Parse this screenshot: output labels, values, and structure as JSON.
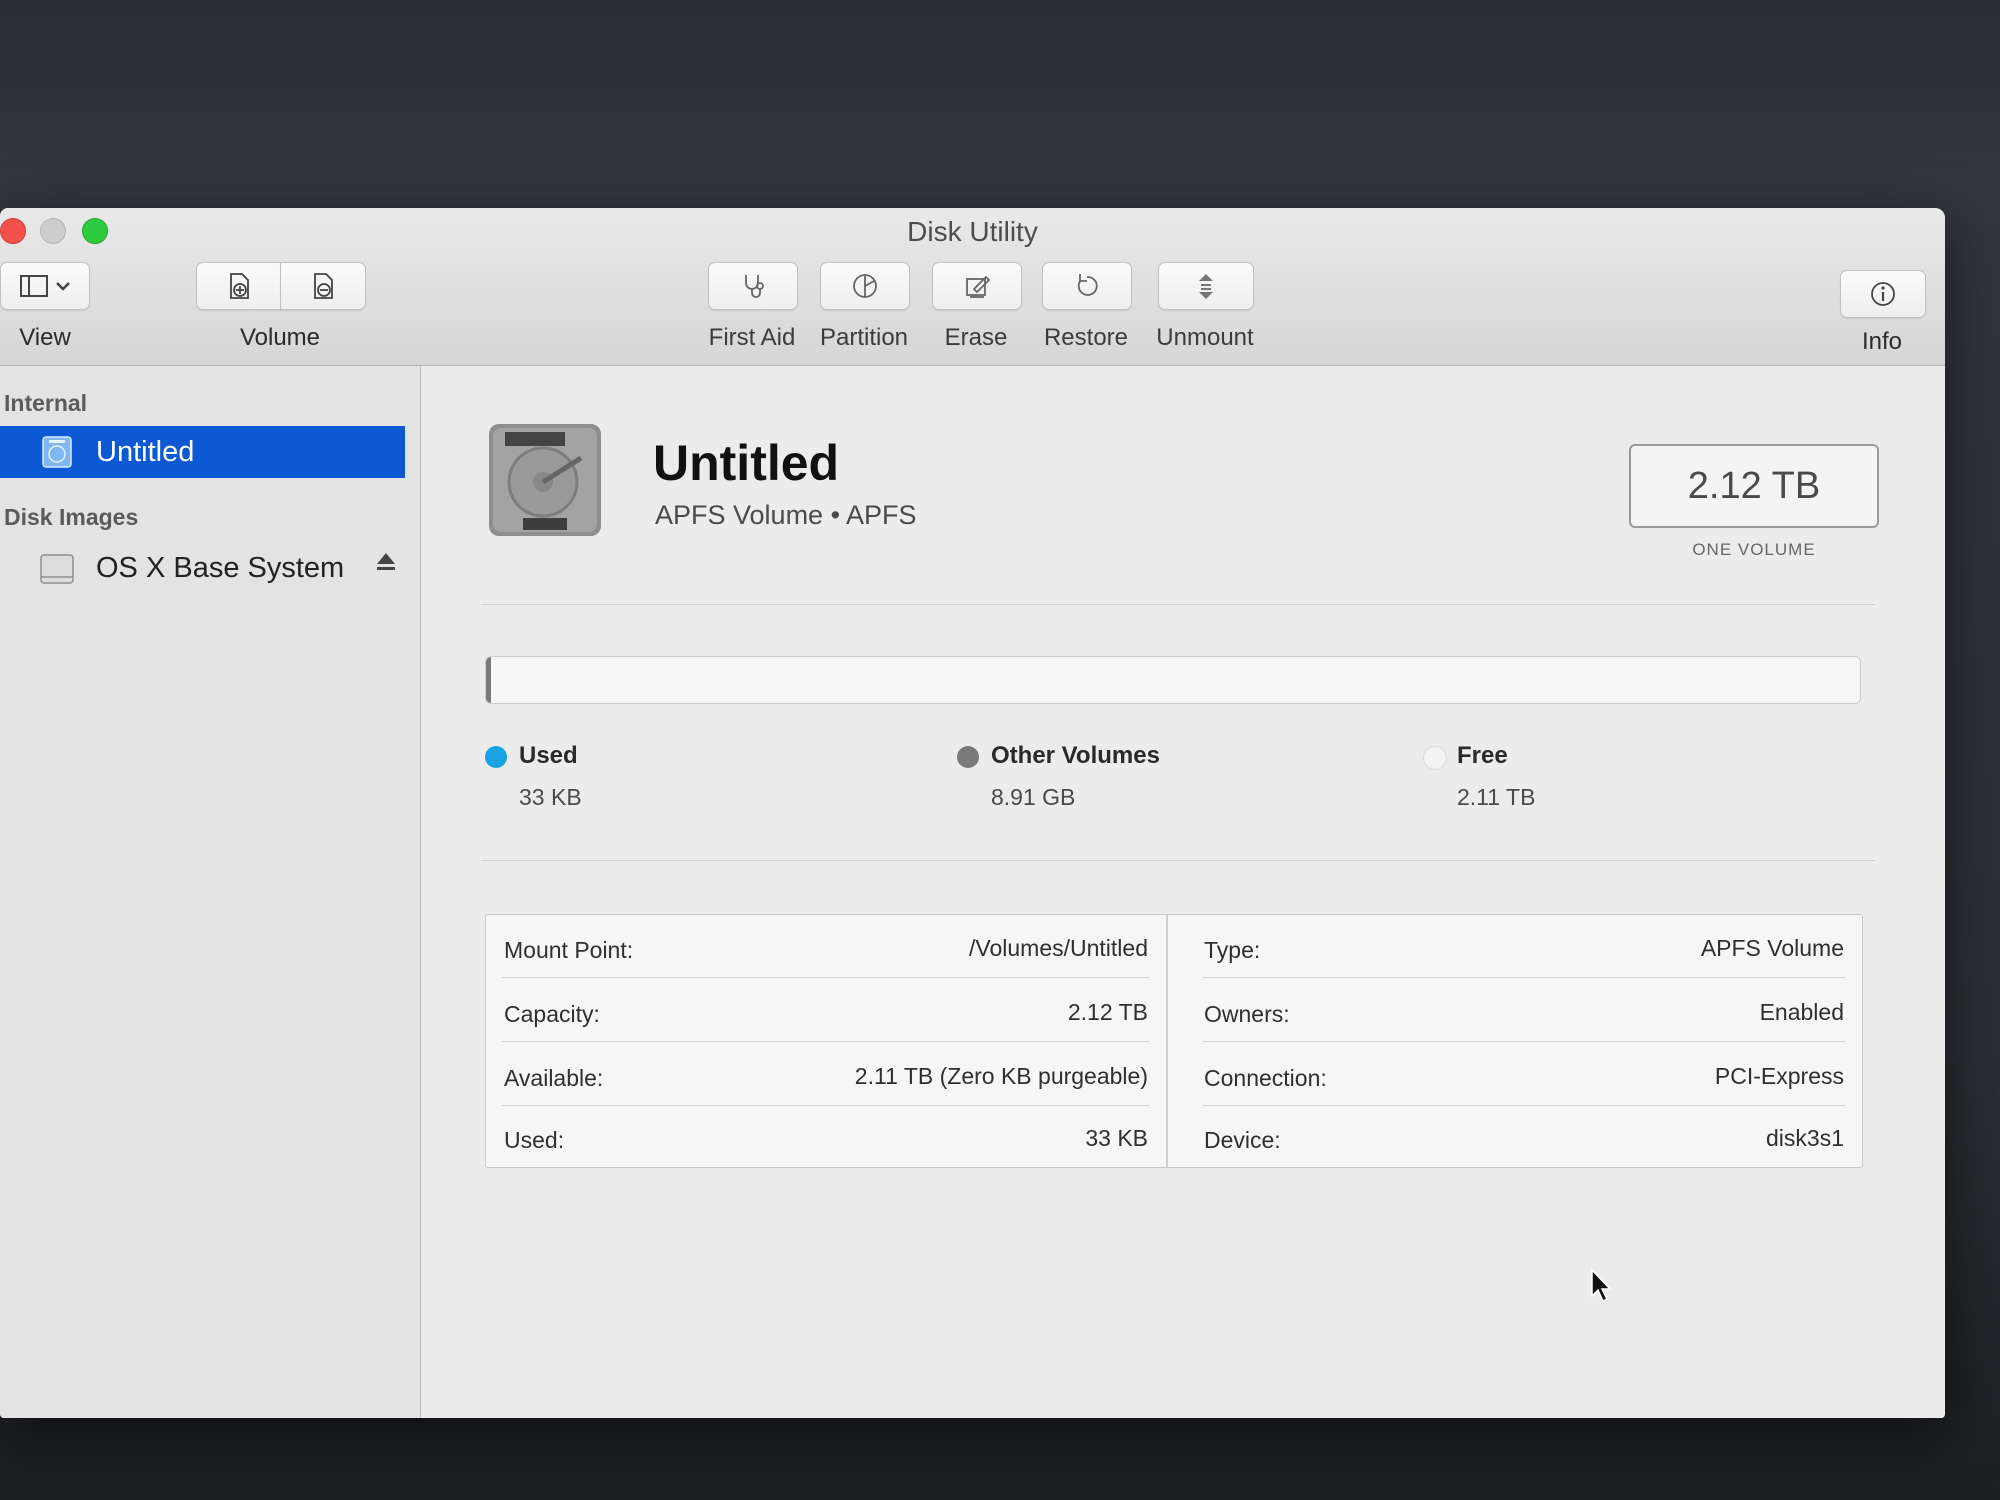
{
  "window": {
    "title": "Disk Utility"
  },
  "toolbar": {
    "view_label": "View",
    "volume_label": "Volume",
    "first_aid_label": "First Aid",
    "partition_label": "Partition",
    "erase_label": "Erase",
    "restore_label": "Restore",
    "unmount_label": "Unmount",
    "info_label": "Info"
  },
  "sidebar": {
    "sections": [
      {
        "header": "Internal",
        "items": [
          {
            "label": "Untitled",
            "selected": true,
            "icon": "internal-disk-icon"
          }
        ]
      },
      {
        "header": "Disk Images",
        "items": [
          {
            "label": "OS X Base System",
            "selected": false,
            "icon": "disk-image-icon",
            "eject": true
          }
        ]
      }
    ]
  },
  "volume": {
    "name": "Untitled",
    "subtitle": "APFS Volume • APFS",
    "capacity_display": "2.12 TB",
    "capacity_caption": "ONE VOLUME"
  },
  "usage": {
    "legend": [
      {
        "name": "Used",
        "value": "33 KB",
        "color": "#1aa3e3",
        "fraction": 0.0
      },
      {
        "name": "Other Volumes",
        "value": "8.91 GB",
        "color": "#7a7a7a",
        "fraction": 0.004
      },
      {
        "name": "Free",
        "value": "2.11 TB",
        "color": "#f3f3f3",
        "fraction": 0.996
      }
    ]
  },
  "details": {
    "left": [
      {
        "key": "Mount Point:",
        "value": "/Volumes/Untitled"
      },
      {
        "key": "Capacity:",
        "value": "2.12 TB"
      },
      {
        "key": "Available:",
        "value": "2.11 TB (Zero KB purgeable)"
      },
      {
        "key": "Used:",
        "value": "33 KB"
      }
    ],
    "right": [
      {
        "key": "Type:",
        "value": "APFS Volume"
      },
      {
        "key": "Owners:",
        "value": "Enabled"
      },
      {
        "key": "Connection:",
        "value": "PCI-Express"
      },
      {
        "key": "Device:",
        "value": "disk3s1"
      }
    ]
  }
}
